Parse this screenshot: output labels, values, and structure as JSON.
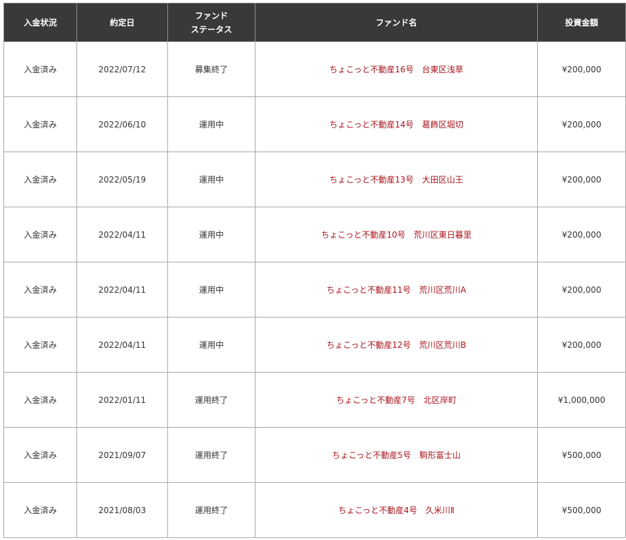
{
  "table": {
    "headers": {
      "payment_status": "入金状況",
      "contract_date": "約定日",
      "fund_status_line1": "ファンド",
      "fund_status_line2": "ステータス",
      "fund_name": "ファンド名",
      "investment_amount": "投資金額"
    },
    "rows": [
      {
        "payment_status": "入金済み",
        "contract_date": "2022/07/12",
        "fund_status": "募集終了",
        "fund_name": "ちょこっと不動産16号　台東区浅草",
        "amount": "¥200,000"
      },
      {
        "payment_status": "入金済み",
        "contract_date": "2022/06/10",
        "fund_status": "運用中",
        "fund_name": "ちょこっと不動産14号　葛飾区堀切",
        "amount": "¥200,000"
      },
      {
        "payment_status": "入金済み",
        "contract_date": "2022/05/19",
        "fund_status": "運用中",
        "fund_name": "ちょこっと不動産13号　大田区山王",
        "amount": "¥200,000"
      },
      {
        "payment_status": "入金済み",
        "contract_date": "2022/04/11",
        "fund_status": "運用中",
        "fund_name": "ちょこっと不動産10号　荒川区東日暮里",
        "amount": "¥200,000"
      },
      {
        "payment_status": "入金済み",
        "contract_date": "2022/04/11",
        "fund_status": "運用中",
        "fund_name": "ちょこっと不動産11号　荒川区荒川A",
        "amount": "¥200,000"
      },
      {
        "payment_status": "入金済み",
        "contract_date": "2022/04/11",
        "fund_status": "運用中",
        "fund_name": "ちょこっと不動産12号　荒川区荒川B",
        "amount": "¥200,000"
      },
      {
        "payment_status": "入金済み",
        "contract_date": "2022/01/11",
        "fund_status": "運用終了",
        "fund_name": "ちょこっと不動産7号　北区岸町",
        "amount": "¥1,000,000"
      },
      {
        "payment_status": "入金済み",
        "contract_date": "2021/09/07",
        "fund_status": "運用終了",
        "fund_name": "ちょこっと不動産5号　駒形富士山",
        "amount": "¥500,000"
      },
      {
        "payment_status": "入金済み",
        "contract_date": "2021/08/03",
        "fund_status": "運用終了",
        "fund_name": "ちょこっと不動産4号　久米川Ⅱ",
        "amount": "¥500,000"
      }
    ]
  },
  "colors": {
    "header_bg": "#3a3838",
    "header_text": "#ffffff",
    "fund_link": "#a8141c",
    "border": "#a8a8a8"
  }
}
